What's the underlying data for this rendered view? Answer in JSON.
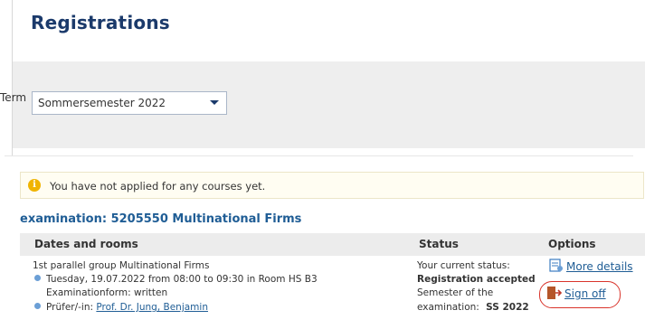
{
  "page": {
    "title": "Registrations"
  },
  "term": {
    "label": "Term",
    "selected": "Sommersemester 2022"
  },
  "notice": {
    "icon": "info-icon",
    "text": "You have not applied for any courses yet."
  },
  "exam": {
    "heading": "examination: 5205550 Multinational Firms",
    "columns": {
      "dates": "Dates and rooms",
      "status": "Status",
      "options": "Options"
    },
    "dates": {
      "group": "1st parallel group Multinational Firms",
      "line1": "Tuesday, 19.07.2022 from 08:00 to 09:30 in Room HS B3",
      "line2": "Examinationform: written",
      "examiner_label": "Prüfer/-in:",
      "examiner_name": "Prof. Dr. Jung, Benjamin"
    },
    "status": {
      "line1": "Your current status:",
      "line2": "Registration accepted",
      "line3": "Semester of the",
      "line4_label": "examination:",
      "line4_value": "SS 2022"
    },
    "options": {
      "more_details": "More details",
      "sign_off": "Sign off"
    }
  },
  "colors": {
    "title": "#1b3a6b",
    "link": "#1f5d95",
    "highlight": "#d9342b",
    "bullet": "#6b9fd6"
  }
}
